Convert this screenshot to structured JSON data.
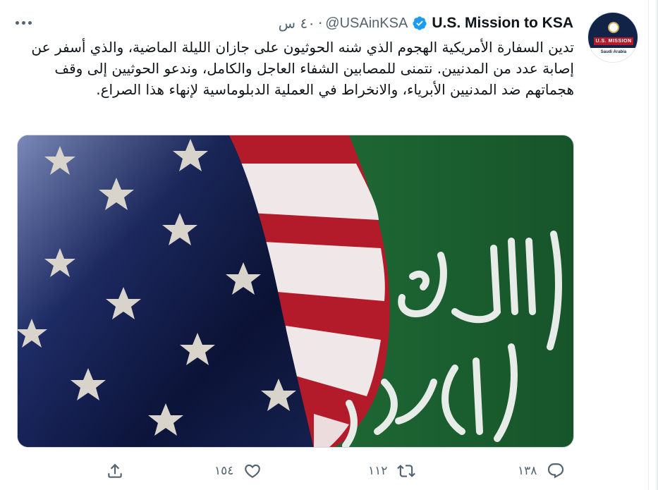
{
  "tweet": {
    "display_name": "U.S. Mission to KSA",
    "handle": "@USAinKSA",
    "separator": "·",
    "time": "٤٠ س",
    "verified": true,
    "body": "تدين السفارة الأمريكية الهجوم الذي شنه الحوثيون على جازان الليلة الماضية، والذي أسفر عن إصابة عدد من المدنيين. نتمنى للمصابين الشفاء العاجل والكامل، وندعو الحوثيين إلى وقف هجماتهم ضد المدنيين الأبرياء، والانخراط في العملية الدبلوماسية لإنهاء هذا الصراع.",
    "avatar": {
      "band_text": "U.S. MISSION",
      "sub_text": "Saudi Arabia"
    },
    "media": {
      "icons": [
        "us-flag",
        "saudi-flag"
      ]
    },
    "actions": {
      "reply_count": "١٣٨",
      "retweet_count": "١١٢",
      "like_count": "١٥٤"
    }
  },
  "colors": {
    "verified": "#1d9bf0",
    "secondary_text": "#536471",
    "navy": "#112448",
    "saudi_green": "#1f6b36",
    "us_red": "#b31b2a"
  },
  "icons": {
    "more": "more-horizontal-icon",
    "verified": "verified-badge-icon",
    "reply": "reply-icon",
    "retweet": "retweet-icon",
    "like": "heart-icon",
    "share": "share-icon"
  }
}
